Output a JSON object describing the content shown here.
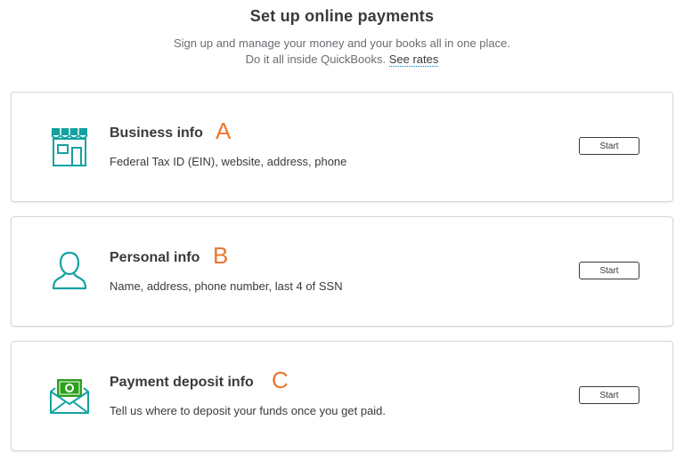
{
  "header": {
    "title": "Set up online payments",
    "subtitle_line1": "Sign up and manage your money and your books all in one place.",
    "subtitle_line2_prefix": "Do it all inside QuickBooks.",
    "see_rates_link": "See rates"
  },
  "cards": [
    {
      "icon": "storefront-icon",
      "title": "Business info",
      "letter": "A",
      "description": "Federal Tax ID (EIN), website, address, phone",
      "button_label": "Start"
    },
    {
      "icon": "person-icon",
      "title": "Personal info",
      "letter": "B",
      "description": "Name, address, phone number, last 4 of SSN",
      "button_label": "Start"
    },
    {
      "icon": "money-envelope-icon",
      "title": "Payment deposit info",
      "letter": "C",
      "description": "Tell us where to deposit your funds once you get paid.",
      "button_label": "Start"
    }
  ],
  "colors": {
    "icon_teal": "#13a2a1",
    "icon_green": "#2ca01c",
    "annotation_orange": "#e8772e",
    "link_underline": "#0077c5"
  }
}
